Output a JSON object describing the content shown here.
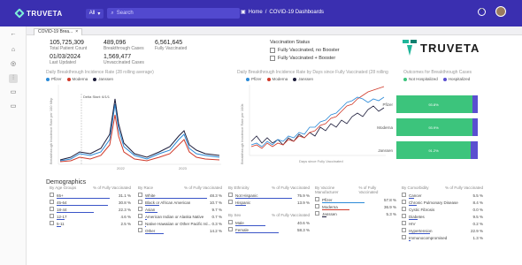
{
  "topbar": {
    "brand": "TRUVETA",
    "filter": "All",
    "search_placeholder": "Search",
    "breadcrumb": [
      "Home",
      "COVID-19 Dashboards"
    ],
    "help": "?"
  },
  "tab": {
    "label": "COVID-19 Brea...",
    "close": "×"
  },
  "stats": [
    {
      "value": "105,725,309",
      "label": "Total Patient Count"
    },
    {
      "value": "489,096",
      "label": "Breakthrough Cases"
    },
    {
      "value": "6,561,645",
      "label": "Fully Vaccinated"
    },
    {
      "value": "01/03/2024",
      "label": "Last Updated"
    },
    {
      "value": "1,569,477",
      "label": "Unvaccinated Cases"
    }
  ],
  "vaccination_status": {
    "title": "Vaccination Status",
    "options": [
      "Fully Vaccinated, no Booster",
      "Fully Vaccinated + Booster"
    ]
  },
  "logo_text": "TRUVETA",
  "chart1": {
    "title": "Daily Breakthrough Incidence Rate (28 rolling average)",
    "legend": [
      "Pfizer",
      "Moderna",
      "Janssen"
    ],
    "ylabel": "Breakthrough Incidence Rate per 100 Mbp",
    "annotation": "Delta Start: 6/1/1",
    "xticks": [
      "2022",
      "2023"
    ]
  },
  "chart2": {
    "title": "Daily Breakthrough Incidence Rate by Days since Fully Vaccinated (28 rolling",
    "legend": [
      "Pfizer",
      "Moderna",
      "Janssen"
    ],
    "xlabel": "Days since Fully Vaccinated",
    "ylabel": "Breakthrough Incidence Rate per 100k"
  },
  "chart3": {
    "title": "Outcomes for Breakthrough Cases",
    "legend": [
      "Not Hospitalized",
      "Hospitalized"
    ],
    "rows": [
      {
        "label": "Pfizer",
        "value": "93.8%"
      },
      {
        "label": "Moderna",
        "value": "93.9%"
      },
      {
        "label": "Janssen",
        "value": "91.2%"
      }
    ]
  },
  "colors": {
    "topbar": "#3a2fb0",
    "pfizer": "#2a8ad8",
    "moderna": "#d03a2a",
    "janssen": "#1b1b3a",
    "green": "#3cc47c",
    "purple": "#5a4fd0",
    "bar": "#3a55c8"
  },
  "demographics": {
    "title": "Demographics",
    "panels": [
      {
        "title": "By Age Groups",
        "col": "% of Fully Vaccinated",
        "rows": [
          [
            "65+",
            "31.1 %"
          ],
          [
            "45-64",
            "30.8 %"
          ],
          [
            "18-44",
            "22.3 %"
          ],
          [
            "12-17",
            "4.6 %"
          ],
          [
            "5-11",
            "2.5 %"
          ]
        ]
      },
      {
        "title": "By Race",
        "col": "% of Fully Vaccinated",
        "rows": [
          [
            "White",
            "48.3 %"
          ],
          [
            "Black or African American",
            "10.7 %"
          ],
          [
            "Asian",
            "9.7 %"
          ],
          [
            "American Indian or Alaska Native",
            "0.7 %"
          ],
          [
            "Native Hawaiian or Other Pacific Isl...",
            "0.3 %"
          ],
          [
            "Other",
            "14.2 %"
          ]
        ]
      },
      {
        "title": "By Ethnicity",
        "col": "% of Fully Vaccinated",
        "rows": [
          [
            "Not Hispanic",
            "75.9 %"
          ],
          [
            "Hispanic",
            "13.9 %"
          ]
        ]
      },
      {
        "title": "By Vaccine Manufacturer",
        "col": "% of Fully Vaccinated",
        "rows": [
          [
            "Pfizer",
            "57.8 %"
          ],
          [
            "Moderna",
            "36.9 %"
          ],
          [
            "Janssen",
            "5.3 %"
          ]
        ]
      },
      {
        "title": "By Comorbidity",
        "col": "% of Fully Vaccinated",
        "rows": [
          [
            "Cancer",
            "5.5 %"
          ],
          [
            "Chronic Pulmonary Disease",
            "8.4 %"
          ],
          [
            "Cystic Fibrosis",
            "0.0 %"
          ],
          [
            "Diabetes",
            "9.5 %"
          ],
          [
            "HIV",
            "0.2 %"
          ],
          [
            "Hypertension",
            "22.9 %"
          ],
          [
            "Immunocompromised",
            "1.3 %"
          ]
        ]
      }
    ],
    "sex": {
      "title": "By Sex",
      "col": "% of Fully Vaccinated",
      "rows": [
        [
          "Male",
          "40.6 %"
        ],
        [
          "Female",
          "58.3 %"
        ]
      ]
    }
  }
}
